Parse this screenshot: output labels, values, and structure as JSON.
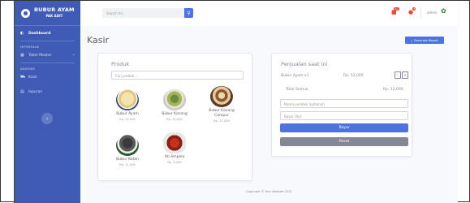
{
  "sidebar": {
    "brand_title": "BUBUR AYAM",
    "brand_sub": "PAK ADIT",
    "dashboard": "Dashboard",
    "heading_interface": "INTERFACE",
    "tabel_master": "Tabel Master",
    "heading_addons": "ADDONS",
    "kasir": "Kasir",
    "laporan": "laporan"
  },
  "topbar": {
    "search_placeholder": "Search for...",
    "alerts_count": "3+",
    "messages_count": "7",
    "user": "admin"
  },
  "page": {
    "title": "Kasir",
    "report_button": "Generate Report"
  },
  "produk": {
    "title": "Produk",
    "search_placeholder": "Cari produk...",
    "items": [
      {
        "name": "Bubur Ayam",
        "price": "Rp. 12,000"
      },
      {
        "name": "Bubur Kacang",
        "price": "Rp. 10,000"
      },
      {
        "name": "Bubur Kacang Campur",
        "price": "Rp. 17,000"
      },
      {
        "name": "Bubur Ketan",
        "price": "Rp. 11,000"
      },
      {
        "name": "Ati Ampela",
        "price": "Rp. 8,000"
      }
    ]
  },
  "penjualan": {
    "title": "Penjualan saat ini",
    "item_label": "Bubur Ayam x1",
    "item_price": "Rp. 12,000",
    "minus": "-",
    "plus": "+",
    "total_label": "Total Semua",
    "total_value": "Rp. 12,000",
    "nama_placeholder": "Nama pembeli (optional)",
    "bayar_placeholder": "Bayar (Rp)",
    "bayar_button": "Bayar",
    "reset_button": "Reset"
  },
  "footer": {
    "copyright": "Copyright © Your Website 2021"
  }
}
